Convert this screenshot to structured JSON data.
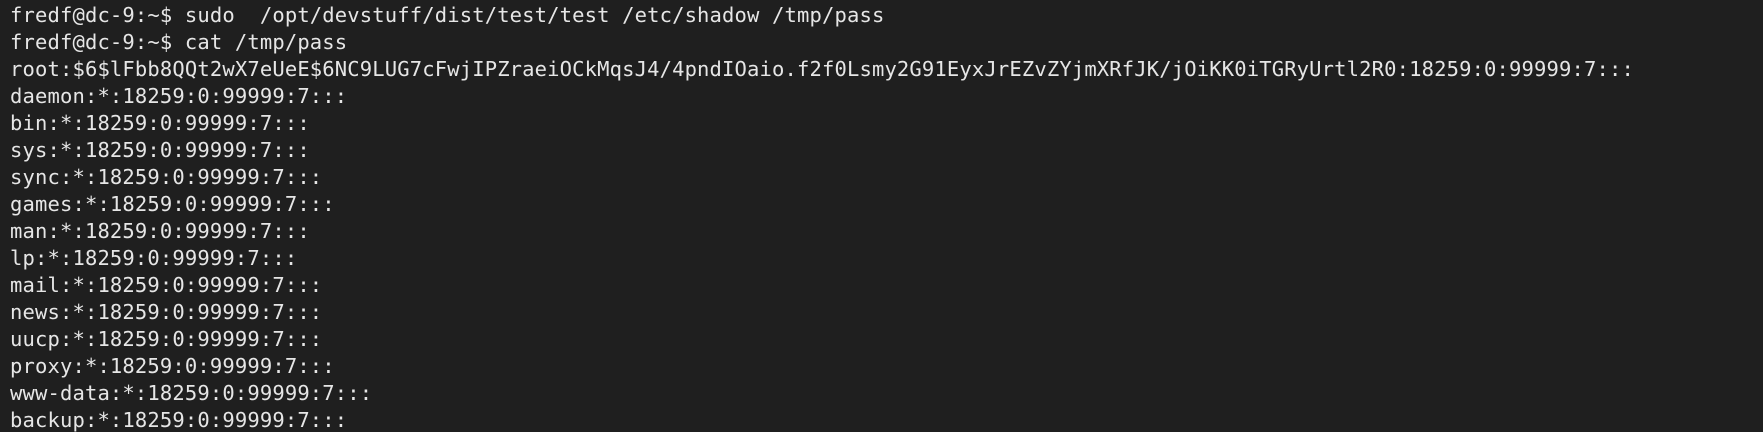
{
  "terminal": {
    "lines": [
      "fredf@dc-9:~$ sudo  /opt/devstuff/dist/test/test /etc/shadow /tmp/pass",
      "fredf@dc-9:~$ cat /tmp/pass",
      "root:$6$lFbb8QQt2wX7eUeE$6NC9LUG7cFwjIPZraeiOCkMqsJ4/4pndIOaio.f2f0Lsmy2G91EyxJrEZvZYjmXRfJK/jOiKK0iTGRyUrtl2R0:18259:0:99999:7:::",
      "daemon:*:18259:0:99999:7:::",
      "bin:*:18259:0:99999:7:::",
      "sys:*:18259:0:99999:7:::",
      "sync:*:18259:0:99999:7:::",
      "games:*:18259:0:99999:7:::",
      "man:*:18259:0:99999:7:::",
      "lp:*:18259:0:99999:7:::",
      "mail:*:18259:0:99999:7:::",
      "news:*:18259:0:99999:7:::",
      "uucp:*:18259:0:99999:7:::",
      "proxy:*:18259:0:99999:7:::",
      "www-data:*:18259:0:99999:7:::",
      "backup:*:18259:0:99999:7:::"
    ],
    "colors": {
      "background": "#1f1f1f",
      "foreground": "#e6e6e6"
    }
  }
}
